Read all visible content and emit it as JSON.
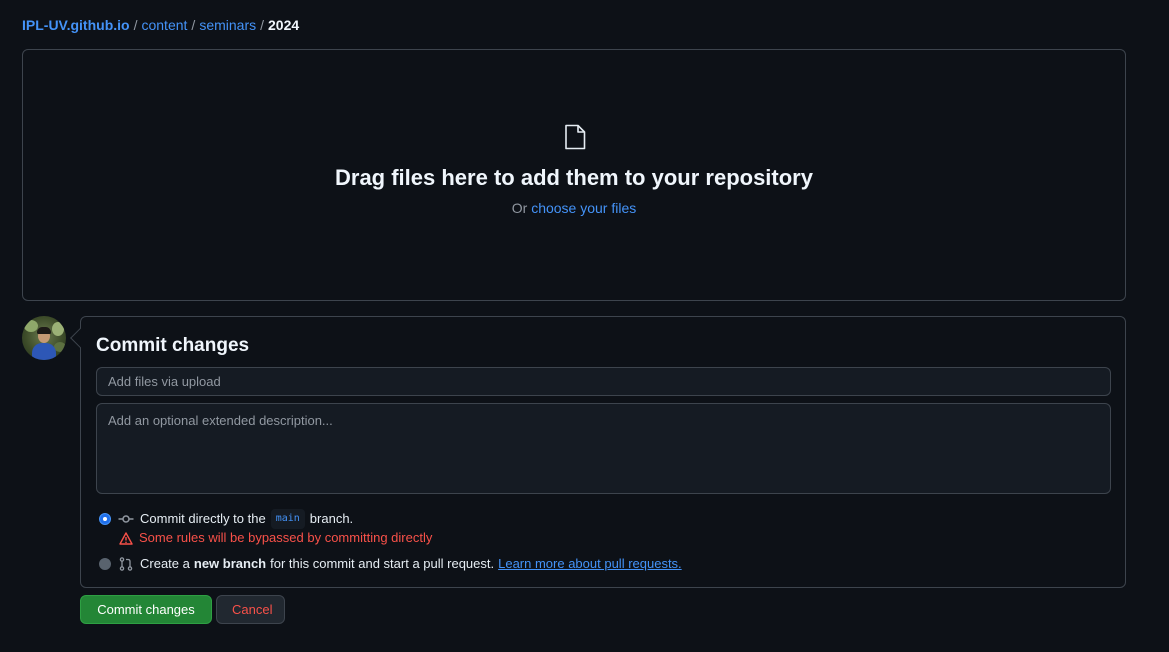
{
  "breadcrumb": {
    "repo": "IPL-UV.github.io",
    "separator": "/",
    "path": [
      "content",
      "seminars"
    ],
    "current": "2024"
  },
  "dropzone": {
    "title": "Drag files here to add them to your repository",
    "prefix": "Or",
    "link": "choose your files",
    "icon": "file-icon"
  },
  "commit": {
    "title": "Commit changes",
    "summary_placeholder": "Add files via upload",
    "summary_value": "",
    "description_placeholder": "Add an optional extended description...",
    "description_value": "",
    "option_direct": {
      "label_before": "Commit directly to the",
      "branch": "main",
      "label_after": "branch.",
      "selected": true,
      "icon": "git-commit-icon"
    },
    "warning": "Some rules will be bypassed by committing directly",
    "option_new_branch": {
      "label_before": "Create a",
      "bold": "new branch",
      "label_after": "for this commit and start a pull request.",
      "link": "Learn more about pull requests.",
      "selected": false,
      "icon": "git-pull-request-icon"
    }
  },
  "buttons": {
    "commit": "Commit changes",
    "cancel": "Cancel"
  },
  "colors": {
    "background": "#0d1117",
    "link": "#4493f8",
    "danger": "#f85149",
    "primary_button": "#238636",
    "border": "#3d444d"
  }
}
